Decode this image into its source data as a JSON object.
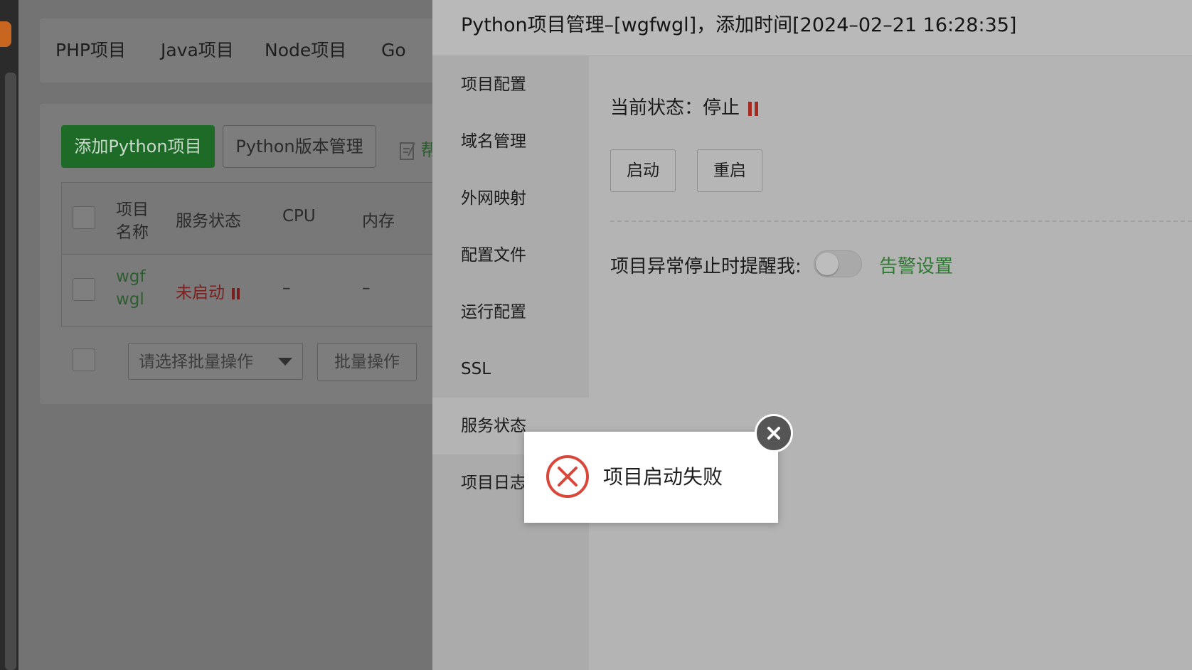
{
  "background": {
    "tabs": [
      "PHP项目",
      "Java项目",
      "Node项目",
      "Go"
    ],
    "buttons": {
      "add_python": "添加Python项目",
      "python_version": "Python版本管理",
      "help_fragment": "帮"
    },
    "table": {
      "headers": {
        "name_line1": "项目",
        "name_line2": "名称",
        "service_status": "服务状态",
        "cpu": "CPU",
        "memory": "内存"
      },
      "rows": [
        {
          "name_line1": "wgf",
          "name_line2": "wgl",
          "status": "未启动",
          "cpu": "–",
          "memory": "–"
        }
      ]
    },
    "batch": {
      "select_placeholder": "请选择批量操作",
      "button": "批量操作"
    }
  },
  "drawer": {
    "title": "Python项目管理–[wgfwgl]，添加时间[2024–02–21 16:28:35]",
    "menu": [
      "项目配置",
      "域名管理",
      "外网映射",
      "配置文件",
      "运行配置",
      "SSL",
      "服务状态",
      "项目日志"
    ],
    "active_menu": "服务状态",
    "content": {
      "status_label": "当前状态：",
      "status_value": "停止",
      "start_button": "启动",
      "restart_button": "重启",
      "remind_label": "项目异常停止时提醒我:",
      "remind_toggle_on": false,
      "alarm_link": "告警设置"
    }
  },
  "toast": {
    "message": "项目启动失败",
    "icon": "error-circle-x-icon"
  },
  "colors": {
    "primary_green": "#2e7a32",
    "error_red": "#d9463a",
    "stop_red": "#a72a22"
  }
}
